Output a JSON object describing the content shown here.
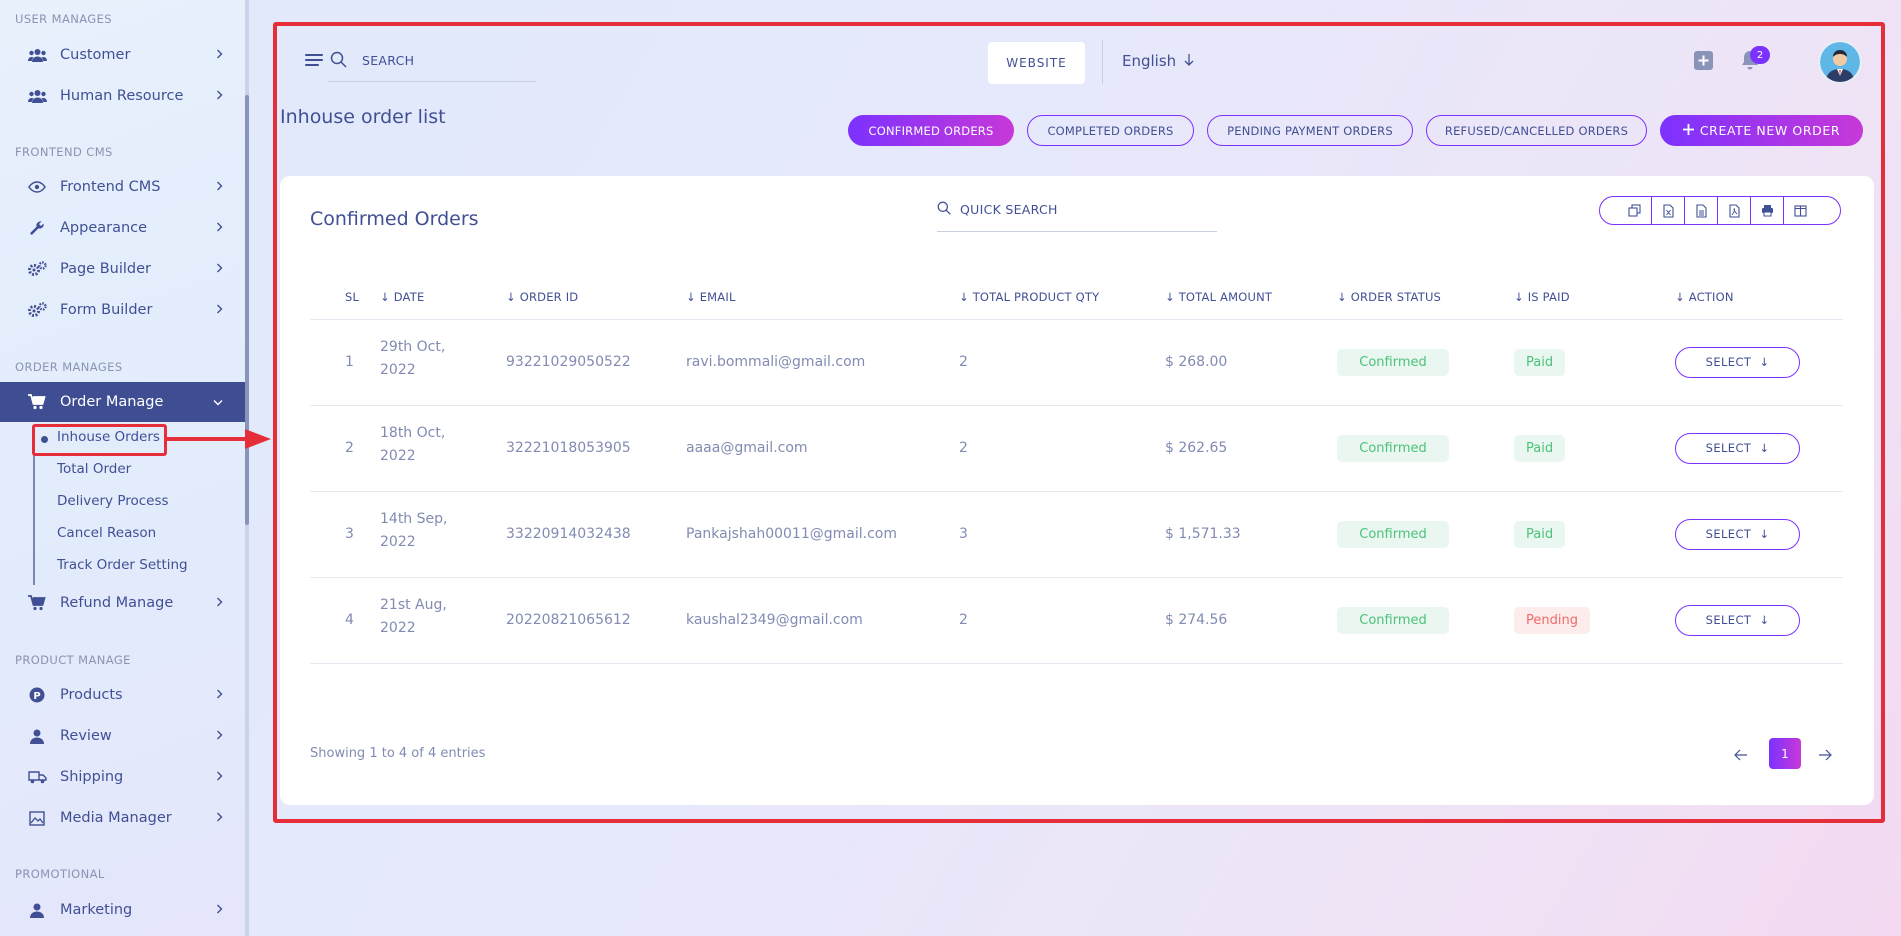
{
  "sidebar": {
    "sections": [
      {
        "label": "USER MANAGES"
      },
      {
        "label": "FRONTEND CMS"
      },
      {
        "label": "ORDER MANAGES"
      },
      {
        "label": "PRODUCT MANAGE"
      },
      {
        "label": "PROMOTIONAL"
      }
    ],
    "items": [
      {
        "label": "Customer",
        "icon": "users-icon"
      },
      {
        "label": "Human Resource",
        "icon": "users-icon"
      },
      {
        "label": "Frontend CMS",
        "icon": "eye-icon"
      },
      {
        "label": "Appearance",
        "icon": "wrench-icon"
      },
      {
        "label": "Page Builder",
        "icon": "gears-icon"
      },
      {
        "label": "Form Builder",
        "icon": "gears-icon"
      },
      {
        "label": "Order Manage",
        "icon": "cart-icon",
        "active": true
      },
      {
        "label": "Refund Manage",
        "icon": "cart-icon"
      },
      {
        "label": "Products",
        "icon": "product-p-icon"
      },
      {
        "label": "Review",
        "icon": "user-icon"
      },
      {
        "label": "Shipping",
        "icon": "truck-icon"
      },
      {
        "label": "Media Manager",
        "icon": "image-icon"
      },
      {
        "label": "Marketing",
        "icon": "user-icon"
      }
    ],
    "subitems": [
      {
        "label": "Inhouse Orders",
        "selected": true
      },
      {
        "label": "Total Order"
      },
      {
        "label": "Delivery Process"
      },
      {
        "label": "Cancel Reason"
      },
      {
        "label": "Track Order Setting"
      }
    ]
  },
  "header": {
    "search_placeholder": "SEARCH",
    "website_label": "WEBSITE",
    "language": "English",
    "notification_count": "2"
  },
  "page": {
    "title": "Inhouse order list",
    "tabs": [
      {
        "label": "CONFIRMED ORDERS",
        "active": true
      },
      {
        "label": "COMPLETED ORDERS"
      },
      {
        "label": "PENDING PAYMENT ORDERS"
      },
      {
        "label": "REFUSED/CANCELLED ORDERS"
      }
    ],
    "create_label": "CREATE NEW ORDER"
  },
  "card": {
    "title": "Confirmed Orders",
    "quick_search": "QUICK SEARCH",
    "columns": [
      "SL",
      "DATE",
      "ORDER ID",
      "EMAIL",
      "TOTAL PRODUCT QTY",
      "TOTAL AMOUNT",
      "ORDER STATUS",
      "IS PAID",
      "ACTION"
    ],
    "rows": [
      {
        "sl": "1",
        "date1": "29th Oct,",
        "date2": "2022",
        "order_id": "93221029050522",
        "email": "ravi.bommali@gmail.com",
        "qty": "2",
        "amount": "$ 268.00",
        "status": "Confirmed",
        "paid": "Paid",
        "action": "SELECT"
      },
      {
        "sl": "2",
        "date1": "18th Oct,",
        "date2": "2022",
        "order_id": "32221018053905",
        "email": "aaaa@gmail.com",
        "qty": "2",
        "amount": "$ 262.65",
        "status": "Confirmed",
        "paid": "Paid",
        "action": "SELECT"
      },
      {
        "sl": "3",
        "date1": "14th Sep,",
        "date2": "2022",
        "order_id": "33220914032438",
        "email": "Pankajshah00011@gmail.com",
        "qty": "3",
        "amount": "$ 1,571.33",
        "status": "Confirmed",
        "paid": "Paid",
        "action": "SELECT"
      },
      {
        "sl": "4",
        "date1": "21st Aug,",
        "date2": "2022",
        "order_id": "20220821065612",
        "email": "kaushal2349@gmail.com",
        "qty": "2",
        "amount": "$ 274.56",
        "status": "Confirmed",
        "paid": "Pending",
        "action": "SELECT"
      }
    ],
    "showing": "Showing 1 to 4 of 4 entries",
    "current_page": "1"
  },
  "colors": {
    "accent": "#7c32ff",
    "accent2": "#c738d8",
    "active_nav": "#3f4d93",
    "highlight": "#e52e3a"
  }
}
